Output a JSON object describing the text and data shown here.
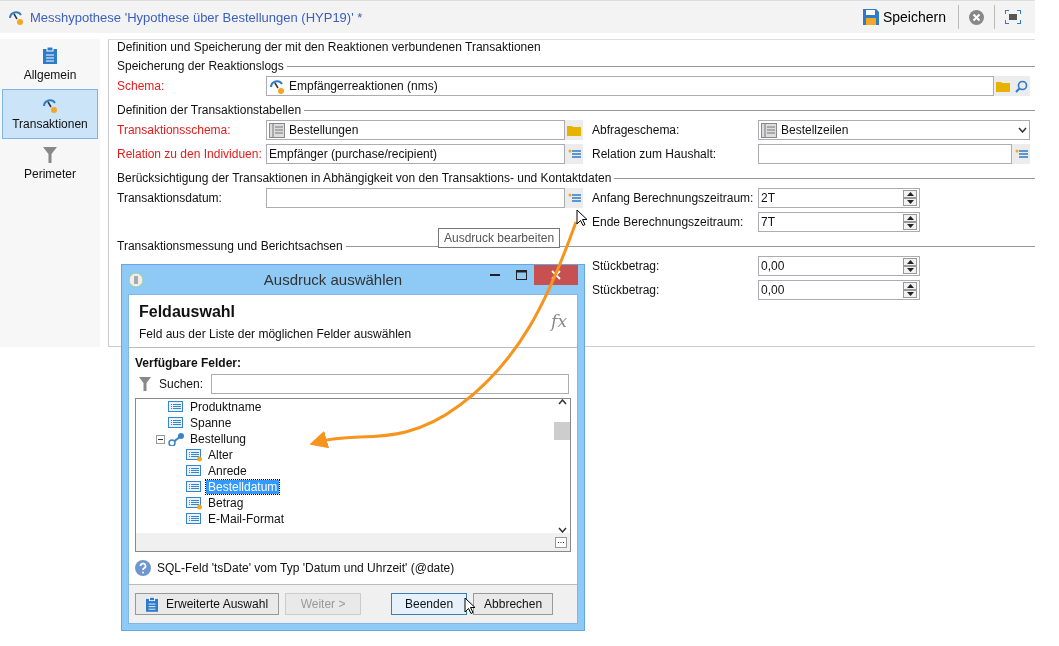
{
  "window": {
    "title": "Messhypothese 'Hypothese über Bestellungen (HYP19)' *",
    "save_label": "Speichern"
  },
  "sidebar": {
    "items": [
      {
        "label": "Allgemein",
        "selected": false
      },
      {
        "label": "Transaktionen",
        "selected": true
      },
      {
        "label": "Perimeter",
        "selected": false
      }
    ]
  },
  "form": {
    "legend": "Definition und Speicherung der mit den Reaktionen verbundenen Transaktionen",
    "groups": [
      {
        "title": "Speicherung der Reaktionslogs",
        "rows": [
          {
            "left": {
              "label": "Schema:",
              "required": true,
              "kind": "schema",
              "value": "Empfängerreaktionen (nms)"
            }
          }
        ]
      },
      {
        "title": "Definition der Transaktionstabellen",
        "rows": [
          {
            "left": {
              "label": "Transaktionsschema:",
              "required": true,
              "kind": "table",
              "value": "Bestellungen"
            },
            "right": {
              "label": "Abfrageschema:",
              "required": false,
              "kind": "combo",
              "value": "Bestellzeilen"
            }
          },
          {
            "left": {
              "label": "Relation zu den Individuen:",
              "required": true,
              "kind": "expr",
              "value": "Empfänger (purchase/recipient)"
            },
            "right": {
              "label": "Relation zum Haushalt:",
              "required": false,
              "kind": "expr"
            }
          }
        ]
      },
      {
        "title": "Berücksichtigung der Transaktionen in Abhängigkeit von den Transaktions- und Kontaktdaten",
        "rows": [
          {
            "left": {
              "label": "Transaktionsdatum:",
              "required": false,
              "kind": "expr"
            },
            "right": {
              "label": "Anfang Berechnungszeitraum:",
              "required": false,
              "kind": "spin",
              "value": "2T"
            }
          },
          {
            "right": {
              "label": "Ende Berechnungszeitraum:",
              "required": false,
              "kind": "spin",
              "value": "7T"
            }
          }
        ]
      },
      {
        "title": "Transaktionsmessung und Berichtsachsen",
        "rows": [
          {
            "right": {
              "label": "Stückbetrag:",
              "required": false,
              "kind": "spin",
              "value": "0,00"
            }
          },
          {
            "right": {
              "label": "Stückbetrag:",
              "required": false,
              "kind": "spin",
              "value": "0,00"
            }
          }
        ]
      }
    ]
  },
  "tooltip": {
    "text": "Ausdruck bearbeiten"
  },
  "dialog": {
    "title": "Ausdruck auswählen",
    "heading": "Feldauswahl",
    "subtitle": "Feld aus der Liste der möglichen Felder auswählen",
    "fx": "fx",
    "fields_label": "Verfügbare Felder:",
    "search": {
      "label": "Suchen:"
    },
    "tree": [
      {
        "label": "Produktname",
        "kind": "field",
        "selected": false
      },
      {
        "label": "Spanne",
        "kind": "field",
        "selected": false
      },
      {
        "label": "Bestellung",
        "kind": "link",
        "selected": false,
        "expanded": true,
        "children": [
          {
            "label": "Alter",
            "kind": "computed",
            "selected": false
          },
          {
            "label": "Anrede",
            "kind": "field",
            "selected": false
          },
          {
            "label": "Bestelldatum",
            "kind": "field",
            "selected": true
          },
          {
            "label": "Betrag",
            "kind": "computed",
            "selected": false
          },
          {
            "label": "E-Mail-Format",
            "kind": "field",
            "selected": false
          }
        ]
      }
    ],
    "info": "SQL-Feld 'tsDate' vom Typ 'Datum und Uhrzeit' (@date)",
    "buttons": [
      {
        "label": "Erweiterte Auswahl",
        "kind": "icon",
        "disabled": false,
        "default": false
      },
      {
        "label": "Weiter >",
        "kind": "plain",
        "disabled": true,
        "default": false
      },
      {
        "label": "Beenden",
        "kind": "plain",
        "disabled": false,
        "default": true
      },
      {
        "label": "Abbrechen",
        "kind": "plain",
        "disabled": false,
        "default": false
      }
    ]
  }
}
